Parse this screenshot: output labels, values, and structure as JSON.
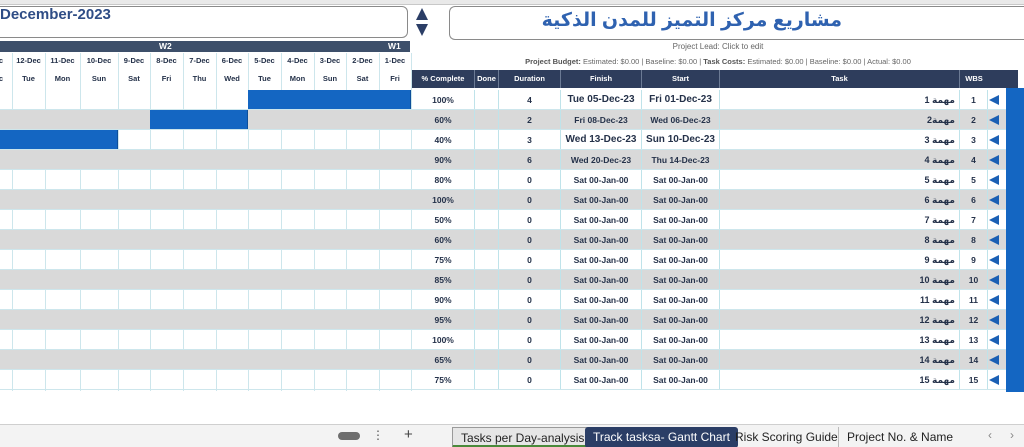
{
  "calendar": {
    "month_title": "December-2023",
    "weeks": [
      {
        "label": "W2"
      },
      {
        "label": "W1"
      }
    ],
    "days": [
      {
        "date": "c",
        "dow": "c"
      },
      {
        "date": "12-Dec",
        "dow": "Tue"
      },
      {
        "date": "11-Dec",
        "dow": "Mon"
      },
      {
        "date": "10-Dec",
        "dow": "Sun"
      },
      {
        "date": "9-Dec",
        "dow": "Sat"
      },
      {
        "date": "8-Dec",
        "dow": "Fri"
      },
      {
        "date": "7-Dec",
        "dow": "Thu"
      },
      {
        "date": "6-Dec",
        "dow": "Wed"
      },
      {
        "date": "5-Dec",
        "dow": "Tue"
      },
      {
        "date": "4-Dec",
        "dow": "Mon"
      },
      {
        "date": "3-Dec",
        "dow": "Sun"
      },
      {
        "date": "2-Dec",
        "dow": "Sat"
      },
      {
        "date": "1-Dec",
        "dow": "Fri"
      }
    ]
  },
  "project": {
    "title": "مشاريع مركز التميز للمدن الذكية",
    "lead": "Project Lead: Click to edit",
    "budget_label": "Project Budget:",
    "budget_text": "Estimated: $0.00 | Baseline: $0.00 |",
    "costs_label": "Task Costs:",
    "costs_text": "Estimated: $0.00 | Baseline: $0.00 | Actual: $0.00"
  },
  "columns": {
    "pct": "% Complete",
    "done": "Done",
    "duration": "Duration",
    "finish": "Finish",
    "start": "Start",
    "task": "Task",
    "wbs": "WBS"
  },
  "tasks": [
    {
      "wbs": "1",
      "task": "مهمة 1",
      "start": "Fri 01-Dec-23",
      "finish": "Tue 05-Dec-23",
      "duration": "4",
      "done": "",
      "pct": "100%"
    },
    {
      "wbs": "2",
      "task": "مهمة2",
      "start": "Wed 06-Dec-23",
      "finish": "Fri 08-Dec-23",
      "duration": "2",
      "done": "",
      "pct": "60%"
    },
    {
      "wbs": "3",
      "task": "مهمة 3",
      "start": "Sun 10-Dec-23",
      "finish": "Wed 13-Dec-23",
      "duration": "3",
      "done": "",
      "pct": "40%"
    },
    {
      "wbs": "4",
      "task": "مهمة 4",
      "start": "Thu 14-Dec-23",
      "finish": "Wed 20-Dec-23",
      "duration": "6",
      "done": "",
      "pct": "90%"
    },
    {
      "wbs": "5",
      "task": "مهمة 5",
      "start": "Sat 00-Jan-00",
      "finish": "Sat 00-Jan-00",
      "duration": "0",
      "done": "",
      "pct": "80%"
    },
    {
      "wbs": "6",
      "task": "مهمة 6",
      "start": "Sat 00-Jan-00",
      "finish": "Sat 00-Jan-00",
      "duration": "0",
      "done": "",
      "pct": "100%"
    },
    {
      "wbs": "7",
      "task": "مهمة 7",
      "start": "Sat 00-Jan-00",
      "finish": "Sat 00-Jan-00",
      "duration": "0",
      "done": "",
      "pct": "50%"
    },
    {
      "wbs": "8",
      "task": "مهمة 8",
      "start": "Sat 00-Jan-00",
      "finish": "Sat 00-Jan-00",
      "duration": "0",
      "done": "",
      "pct": "60%"
    },
    {
      "wbs": "9",
      "task": "مهمة 9",
      "start": "Sat 00-Jan-00",
      "finish": "Sat 00-Jan-00",
      "duration": "0",
      "done": "",
      "pct": "75%"
    },
    {
      "wbs": "10",
      "task": "مهمة 10",
      "start": "Sat 00-Jan-00",
      "finish": "Sat 00-Jan-00",
      "duration": "0",
      "done": "",
      "pct": "85%"
    },
    {
      "wbs": "11",
      "task": "مهمة 11",
      "start": "Sat 00-Jan-00",
      "finish": "Sat 00-Jan-00",
      "duration": "0",
      "done": "",
      "pct": "90%"
    },
    {
      "wbs": "12",
      "task": "مهمة 12",
      "start": "Sat 00-Jan-00",
      "finish": "Sat 00-Jan-00",
      "duration": "0",
      "done": "",
      "pct": "95%"
    },
    {
      "wbs": "13",
      "task": "مهمة 13",
      "start": "Sat 00-Jan-00",
      "finish": "Sat 00-Jan-00",
      "duration": "0",
      "done": "",
      "pct": "100%"
    },
    {
      "wbs": "14",
      "task": "مهمة 14",
      "start": "Sat 00-Jan-00",
      "finish": "Sat 00-Jan-00",
      "duration": "0",
      "done": "",
      "pct": "65%"
    },
    {
      "wbs": "15",
      "task": "مهمة 15",
      "start": "Sat 00-Jan-00",
      "finish": "Sat 00-Jan-00",
      "duration": "0",
      "done": "",
      "pct": "75%"
    }
  ],
  "sheet_tabs": [
    {
      "label": "Tasks per Day-analysis",
      "active": true
    },
    {
      "label": "Track tasksa- Gantt Chart",
      "active": false
    },
    {
      "label": "Risk Scoring Guide",
      "active": false
    },
    {
      "label": "Project No. & Name",
      "active": false
    }
  ],
  "ui": {
    "more_icon": "⋮",
    "add_icon": "+",
    "prev_icon": "‹",
    "next_icon": "›"
  },
  "colors": {
    "bar": "#1466c2",
    "header": "#2e3d5c",
    "title": "#2f62b0"
  }
}
